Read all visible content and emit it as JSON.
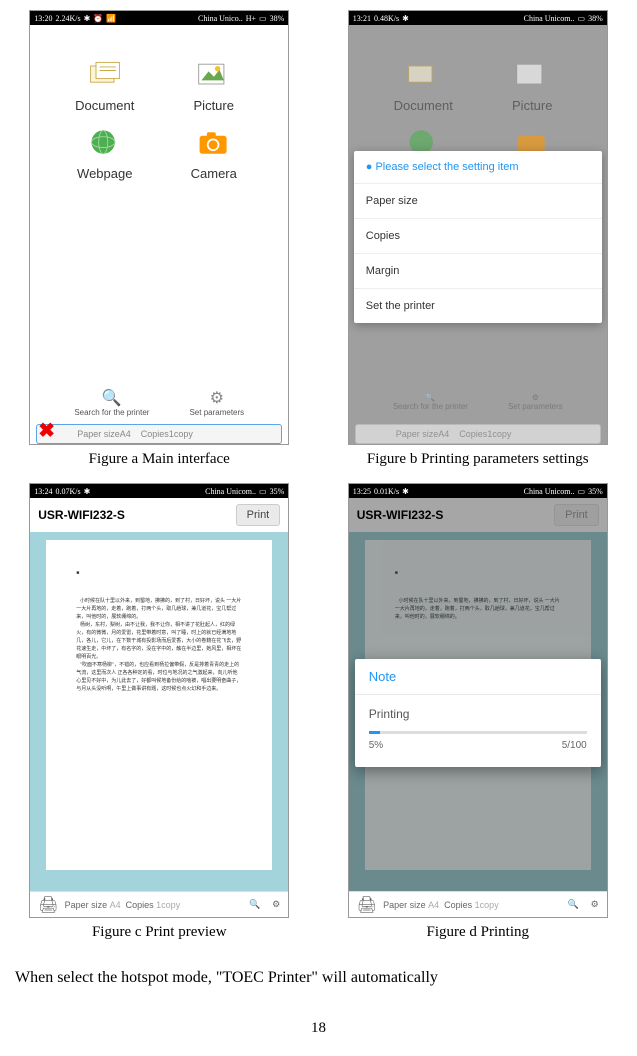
{
  "figures": {
    "a": {
      "status": {
        "time": "13:20",
        "speed": "2.24K/s",
        "carrier": "China Unico..",
        "signal": "H+",
        "battery": "38%"
      },
      "grid": [
        {
          "label": "Document",
          "icon": "document-icon"
        },
        {
          "label": "Picture",
          "icon": "picture-icon"
        },
        {
          "label": "Webpage",
          "icon": "webpage-icon"
        },
        {
          "label": "Camera",
          "icon": "camera-icon"
        }
      ],
      "bottom": {
        "search": "Search for the printer",
        "set": "Set parameters"
      },
      "strip": {
        "paper_label": "Paper size",
        "paper_val": "A4",
        "copies_label": "Copies",
        "copies_val": "1copy"
      },
      "caption": "Figure a Main interface"
    },
    "b": {
      "status": {
        "time": "13:21",
        "speed": "0.48K/s",
        "carrier": "China Unicom..",
        "signal": "",
        "battery": "38%"
      },
      "grid": [
        {
          "label": "Document"
        },
        {
          "label": "Picture"
        },
        {
          "label": "Webpage"
        },
        {
          "label": "Camera"
        }
      ],
      "popup": {
        "header": "Please select the setting item",
        "items": [
          "Paper size",
          "Copies",
          "Margin",
          "Set the printer"
        ]
      },
      "bottom": {
        "search": "Search for the printer",
        "set": "Set parameters"
      },
      "strip": {
        "paper_label": "Paper size",
        "paper_val": "A4",
        "copies_label": "Copies",
        "copies_val": "1copy"
      },
      "caption": "Figure b Printing parameters settings"
    },
    "c": {
      "status": {
        "time": "13:24",
        "speed": "0.07K/s",
        "carrier": "China Unicom..",
        "battery": "35%"
      },
      "title": "USR-WIFI232-S",
      "print_btn": "Print",
      "strip": {
        "paper_label": "Paper size",
        "paper_val": "A4",
        "copies_label": "Copies",
        "copies_val": "1copy"
      },
      "caption": "Figure c Print preview"
    },
    "d": {
      "status": {
        "time": "13:25",
        "speed": "0.01K/s",
        "carrier": "China Unicom..",
        "battery": "35%"
      },
      "title": "USR-WIFI232-S",
      "print_btn": "Print",
      "popup": {
        "header": "Note",
        "label": "Printing",
        "pct": "5%",
        "count": "5/100"
      },
      "strip": {
        "paper_label": "Paper size",
        "paper_val": "A4",
        "copies_label": "Copies",
        "copies_val": "1copy"
      },
      "caption": "Figure d Printing"
    }
  },
  "body_text": "When select the hotspot mode, \"TOEC Printer\" will automatically",
  "page_number": "18"
}
